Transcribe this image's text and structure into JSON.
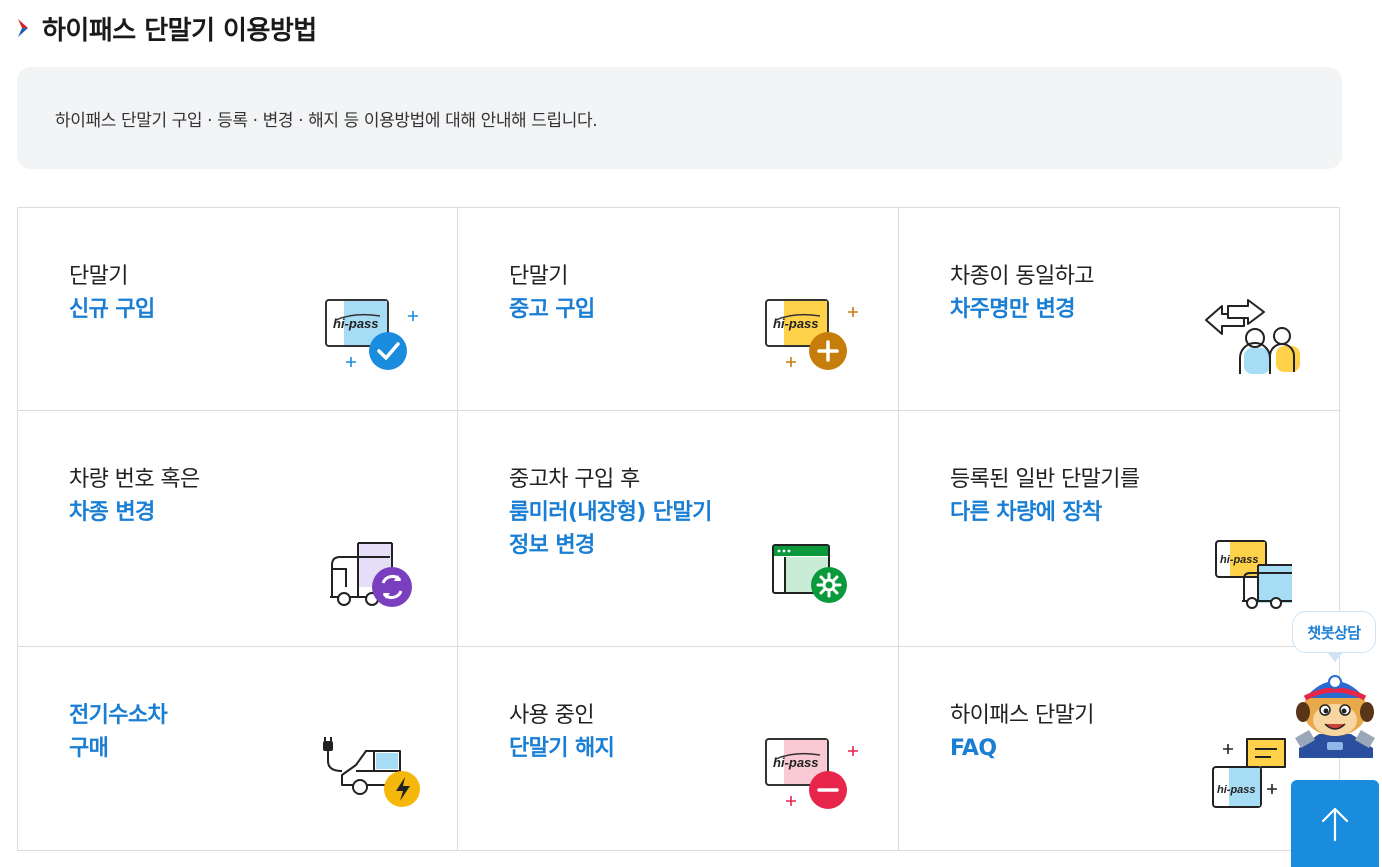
{
  "header": {
    "title": "하이패스 단말기 이용방법"
  },
  "intro": {
    "text": "하이패스 단말기 구입 · 등록 · 변경 · 해지 등 이용방법에 대해 안내해 드립니다."
  },
  "cards": [
    {
      "line1": "단말기",
      "blue": "신규 구입",
      "icon": "hipass-new-purchase-icon"
    },
    {
      "line1": "단말기",
      "blue": "중고 구입",
      "icon": "hipass-used-purchase-icon"
    },
    {
      "line1": "차종이 동일하고",
      "blue": "차주명만 변경",
      "icon": "owner-change-icon"
    },
    {
      "line1": "차량 번호 혹은",
      "blue": "차종 변경",
      "icon": "vehicle-change-icon"
    },
    {
      "line1": "중고차 구입 후",
      "blue": "룸미러(내장형) 단말기",
      "blue2": "정보 변경",
      "icon": "settings-window-icon"
    },
    {
      "line1": "등록된 일반 단말기를",
      "blue": "다른 차량에 장착",
      "icon": "hipass-truck-icon"
    },
    {
      "line1": "",
      "blue": "전기수소차",
      "blue2": "구매",
      "icon": "ev-charging-car-icon"
    },
    {
      "line1": "사용 중인",
      "blue": "단말기 해지",
      "icon": "hipass-cancel-icon"
    },
    {
      "line1": "하이패스 단말기",
      "blue": "FAQ",
      "icon": "faq-chat-icon"
    }
  ],
  "chatbot": {
    "label": "챗봇상담"
  },
  "colors": {
    "accent": "#1a7fd4",
    "top_button": "#1a8cde",
    "intro_bg": "#f3f4f6"
  }
}
